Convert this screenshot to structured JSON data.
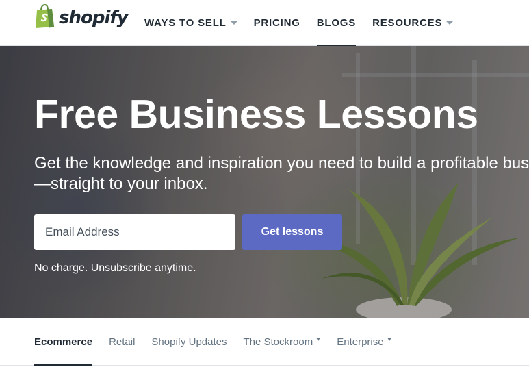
{
  "header": {
    "logo_text": "shopify",
    "nav": [
      {
        "label": "WAYS TO SELL",
        "has_dropdown": true,
        "active": false
      },
      {
        "label": "PRICING",
        "has_dropdown": false,
        "active": false
      },
      {
        "label": "BLOGS",
        "has_dropdown": false,
        "active": true
      },
      {
        "label": "RESOURCES",
        "has_dropdown": true,
        "active": false
      }
    ]
  },
  "hero": {
    "title": "Free Business Lessons",
    "subtitle": "Get the knowledge and inspiration you need to build a profitable business—straight to your inbox.",
    "email_placeholder": "Email Address",
    "email_value": "",
    "cta_label": "Get lessons",
    "note": "No charge. Unsubscribe anytime."
  },
  "categories": [
    {
      "label": "Ecommerce",
      "active": true,
      "has_dropdown": false
    },
    {
      "label": "Retail",
      "active": false,
      "has_dropdown": false
    },
    {
      "label": "Shopify Updates",
      "active": false,
      "has_dropdown": false
    },
    {
      "label": "The Stockroom",
      "active": false,
      "has_dropdown": true
    },
    {
      "label": "Enterprise",
      "active": false,
      "has_dropdown": true
    }
  ],
  "colors": {
    "brand_green": "#95bf47",
    "brand_green_dark": "#5e8e3e",
    "cta_indigo": "#5c6ac4",
    "text_dark": "#212b36",
    "text_muted": "#637381"
  },
  "icons": {
    "logo": "shopping-bag-icon",
    "dropdown": "caret-down-icon"
  }
}
